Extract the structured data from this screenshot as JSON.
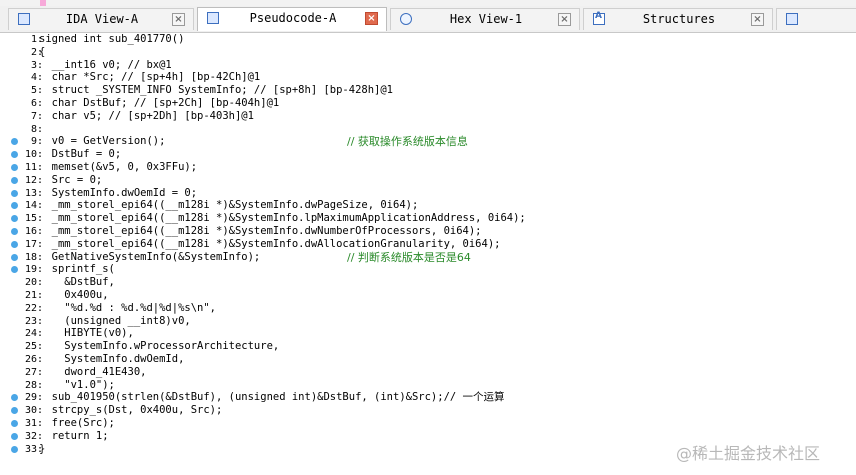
{
  "tabs": [
    {
      "label": "IDA View-A",
      "icon": "ida-view-icon",
      "active": false
    },
    {
      "label": "Pseudocode-A",
      "icon": "pseudocode-icon",
      "active": true
    },
    {
      "label": "Hex View-1",
      "icon": "hex-view-icon",
      "active": false
    },
    {
      "label": "Structures",
      "icon": "structures-icon",
      "active": false
    }
  ],
  "close_glyph": "×",
  "code_lines": [
    {
      "n": "1",
      "bp": false,
      "code": "signed int sub_401770()",
      "comment": ""
    },
    {
      "n": "2",
      "bp": false,
      "code": "{",
      "comment": ""
    },
    {
      "n": "3",
      "bp": false,
      "code": "  __int16 v0; // bx@1",
      "comment": ""
    },
    {
      "n": "4",
      "bp": false,
      "code": "  char *Src; // [sp+4h] [bp-42Ch]@1",
      "comment": ""
    },
    {
      "n": "5",
      "bp": false,
      "code": "  struct _SYSTEM_INFO SystemInfo; // [sp+8h] [bp-428h]@1",
      "comment": ""
    },
    {
      "n": "6",
      "bp": false,
      "code": "  char DstBuf; // [sp+2Ch] [bp-404h]@1",
      "comment": ""
    },
    {
      "n": "7",
      "bp": false,
      "code": "  char v5; // [sp+2Dh] [bp-403h]@1",
      "comment": ""
    },
    {
      "n": "8",
      "bp": false,
      "code": "",
      "comment": ""
    },
    {
      "n": "9",
      "bp": true,
      "code": "  v0 = GetVersion();",
      "comment": "// 获取操作系统版本信息"
    },
    {
      "n": "10",
      "bp": true,
      "code": "  DstBuf = 0;",
      "comment": ""
    },
    {
      "n": "11",
      "bp": true,
      "code": "  memset(&v5, 0, 0x3FFu);",
      "comment": ""
    },
    {
      "n": "12",
      "bp": true,
      "code": "  Src = 0;",
      "comment": ""
    },
    {
      "n": "13",
      "bp": true,
      "code": "  SystemInfo.dwOemId = 0;",
      "comment": ""
    },
    {
      "n": "14",
      "bp": true,
      "code": "  _mm_storel_epi64((__m128i *)&SystemInfo.dwPageSize, 0i64);",
      "comment": ""
    },
    {
      "n": "15",
      "bp": true,
      "code": "  _mm_storel_epi64((__m128i *)&SystemInfo.lpMaximumApplicationAddress, 0i64);",
      "comment": ""
    },
    {
      "n": "16",
      "bp": true,
      "code": "  _mm_storel_epi64((__m128i *)&SystemInfo.dwNumberOfProcessors, 0i64);",
      "comment": ""
    },
    {
      "n": "17",
      "bp": true,
      "code": "  _mm_storel_epi64((__m128i *)&SystemInfo.dwAllocationGranularity, 0i64);",
      "comment": ""
    },
    {
      "n": "18",
      "bp": true,
      "code": "  GetNativeSystemInfo(&SystemInfo);",
      "comment": "// 判断系统版本是否是64"
    },
    {
      "n": "19",
      "bp": true,
      "code": "  sprintf_s(",
      "comment": ""
    },
    {
      "n": "20",
      "bp": false,
      "code": "    &DstBuf,",
      "comment": ""
    },
    {
      "n": "21",
      "bp": false,
      "code": "    0x400u,",
      "comment": ""
    },
    {
      "n": "22",
      "bp": false,
      "code": "    \"%d.%d : %d.%d|%d|%s\\n\",",
      "comment": ""
    },
    {
      "n": "23",
      "bp": false,
      "code": "    (unsigned __int8)v0,",
      "comment": ""
    },
    {
      "n": "24",
      "bp": false,
      "code": "    HIBYTE(v0),",
      "comment": ""
    },
    {
      "n": "25",
      "bp": false,
      "code": "    SystemInfo.wProcessorArchitecture,",
      "comment": ""
    },
    {
      "n": "26",
      "bp": false,
      "code": "    SystemInfo.dwOemId,",
      "comment": ""
    },
    {
      "n": "27",
      "bp": false,
      "code": "    dword_41E430,",
      "comment": ""
    },
    {
      "n": "28",
      "bp": false,
      "code": "    \"v1.0\");",
      "comment": ""
    },
    {
      "n": "29",
      "bp": true,
      "code": "  sub_401950(strlen(&DstBuf), (unsigned int)&DstBuf, (int)&Src);// 一个运算",
      "comment": ""
    },
    {
      "n": "30",
      "bp": true,
      "code": "  strcpy_s(Dst, 0x400u, Src);",
      "comment": ""
    },
    {
      "n": "31",
      "bp": true,
      "code": "  free(Src);",
      "comment": ""
    },
    {
      "n": "32",
      "bp": true,
      "code": "  return 1;",
      "comment": ""
    },
    {
      "n": "33",
      "bp": true,
      "code": "}",
      "comment": ""
    }
  ],
  "watermark": "@稀土掘金技术社区"
}
